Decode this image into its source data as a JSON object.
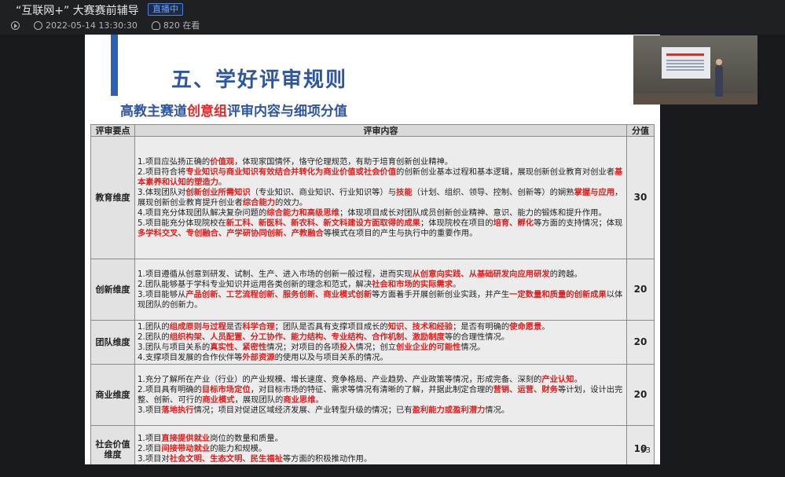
{
  "header": {
    "title": "“互联网+” 大赛赛前辅导",
    "live_badge": "直播中",
    "datetime": "2022-05-14 13:30:30",
    "viewers": "820 在看"
  },
  "slide": {
    "heading": "五、学好评审规则",
    "subheading_before": "高教主赛道",
    "subheading_highlight": "创意组",
    "subheading_after": "评审内容与细项分值",
    "page_number": "33",
    "col_headers": [
      "评审要点",
      "评审内容",
      "分值"
    ],
    "rows": [
      {
        "key": "教育维度",
        "score": "30",
        "items": [
          [
            [
              "1.项目应弘扬正确的",
              0
            ],
            [
              "价值观",
              1
            ],
            [
              "，体现家国情怀，恪守伦理规范，有助于培育创新创业精神。",
              0
            ]
          ],
          [
            [
              "2.项目符合将",
              0
            ],
            [
              "专业知识与商业知识有效结合并转化为商业价值或社会价值",
              1
            ],
            [
              "的创新创业基本过程和基本逻辑，展现创新创业教育对创业者",
              0
            ],
            [
              "基本素养和认知的塑造力",
              1
            ],
            [
              "。",
              0
            ]
          ],
          [
            [
              "3.体现团队对",
              0
            ],
            [
              "创新创业所需知识",
              1
            ],
            [
              "（专业知识、商业知识、行业知识等）与",
              0
            ],
            [
              "技能",
              1
            ],
            [
              "（计划、组织、领导、控制、创新等）的娴熟",
              0
            ],
            [
              "掌握与应用",
              1
            ],
            [
              "，展现创新创业教育提升创业者",
              0
            ],
            [
              "综合能力",
              1
            ],
            [
              "的效力。",
              0
            ]
          ],
          [
            [
              "4.项目充分体现团队解决复杂问题的",
              0
            ],
            [
              "综合能力和高级思维",
              1
            ],
            [
              "；体现项目成长对团队成员创新创业精神、意识、能力的锻炼和提升作用。",
              0
            ]
          ],
          [
            [
              "5.项目能充分体现院校在",
              0
            ],
            [
              "新工科、新医科、新农科、新文科建设方面取得的成果",
              1
            ],
            [
              "；体现院校在项目的",
              0
            ],
            [
              "培育、孵化",
              1
            ],
            [
              "等方面的支持情况；体现",
              0
            ],
            [
              "多学科交叉、专创融合、产学研协同创新、产教融合",
              1
            ],
            [
              "等模式在项目的产生与执行中的重要作用。",
              0
            ]
          ]
        ]
      },
      {
        "key": "创新维度",
        "score": "20",
        "items": [
          [
            [
              "1.项目遵循从创意到研发、试制、生产、进入市场的创新一般过程，进而实现",
              0
            ],
            [
              "从创意向实践、从基础研发向应用研发",
              1
            ],
            [
              "的跨越。",
              0
            ]
          ],
          [
            [
              "2.团队能够基于学科专业知识并运用各类创新的理念和范式，解决",
              0
            ],
            [
              "社会和市场的实际需求",
              1
            ],
            [
              "。",
              0
            ]
          ],
          [
            [
              "3.项目能够从",
              0
            ],
            [
              "产品创新、工艺流程创新、服务创新、商业模式创新",
              1
            ],
            [
              "等方面着手开展创新创业实践，并产生",
              0
            ],
            [
              "一定数量和质量的创新成果",
              1
            ],
            [
              "以体现团队的创新力。",
              0
            ]
          ]
        ]
      },
      {
        "key": "团队维度",
        "score": "20",
        "items": [
          [
            [
              "1.团队的",
              0
            ],
            [
              "组成原则与过程",
              1
            ],
            [
              "是否",
              0
            ],
            [
              "科学合理",
              1
            ],
            [
              "；团队是否具有支撑项目成长的",
              0
            ],
            [
              "知识、技术和经验",
              1
            ],
            [
              "；是否有明确的",
              0
            ],
            [
              "使命愿景",
              1
            ],
            [
              "。",
              0
            ]
          ],
          [
            [
              "2.团队的",
              0
            ],
            [
              "组织构架、人员配置、分工协作、能力结构、专业结构、合作机制、激励制度",
              1
            ],
            [
              "等的合理性情况。",
              0
            ]
          ],
          [
            [
              "3.团队与项目关系的",
              0
            ],
            [
              "真实性、紧密性",
              1
            ],
            [
              "情况；对项目的各项",
              0
            ],
            [
              "投入",
              1
            ],
            [
              "情况；创立",
              0
            ],
            [
              "创业企业的可能性",
              1
            ],
            [
              "情况。",
              0
            ]
          ],
          [
            [
              "4.支撑项目发展的合作伙伴等",
              0
            ],
            [
              "外部资源",
              1
            ],
            [
              "的使用以及与项目关系的情况。",
              0
            ]
          ]
        ]
      },
      {
        "key": "商业维度",
        "score": "20",
        "items": [
          [
            [
              "1.充分了解所在产业（行业）的产业规模、增长速度、竞争格局、产业趋势、产业政策等情况，形成完备、深刻的",
              0
            ],
            [
              "产业认知",
              1
            ],
            [
              "。",
              0
            ]
          ],
          [
            [
              "2.项目具有明确的",
              0
            ],
            [
              "目标市场定位",
              1
            ],
            [
              "，对目标市场的特征、需求等情况有清晰的了解，并据此制定合理的",
              0
            ],
            [
              "营销、运营、财务",
              1
            ],
            [
              "等计划，设计出完整、创新、可行的",
              0
            ],
            [
              "商业模式",
              1
            ],
            [
              "，展现团队的",
              0
            ],
            [
              "商业思维",
              1
            ],
            [
              "。",
              0
            ]
          ],
          [
            [
              "3.项目",
              0
            ],
            [
              "落地执行",
              1
            ],
            [
              "情况；项目对促进区域经济发展、产业转型升级的情况；已有",
              0
            ],
            [
              "盈利能力或盈利潜力",
              1
            ],
            [
              "情况。",
              0
            ]
          ]
        ]
      },
      {
        "key": "社会价值维度",
        "score": "10",
        "items": [
          [
            [
              "1.项目",
              0
            ],
            [
              "直接提供就业",
              1
            ],
            [
              "岗位的数量和质量。",
              0
            ]
          ],
          [
            [
              "2.项目",
              0
            ],
            [
              "间接带动就业",
              1
            ],
            [
              "的能力和规模。",
              0
            ]
          ],
          [
            [
              "3.项目对",
              0
            ],
            [
              "社会文明、生态文明、民生福祉",
              1
            ],
            [
              "等方面的积极推动作用。",
              0
            ]
          ]
        ]
      }
    ]
  }
}
